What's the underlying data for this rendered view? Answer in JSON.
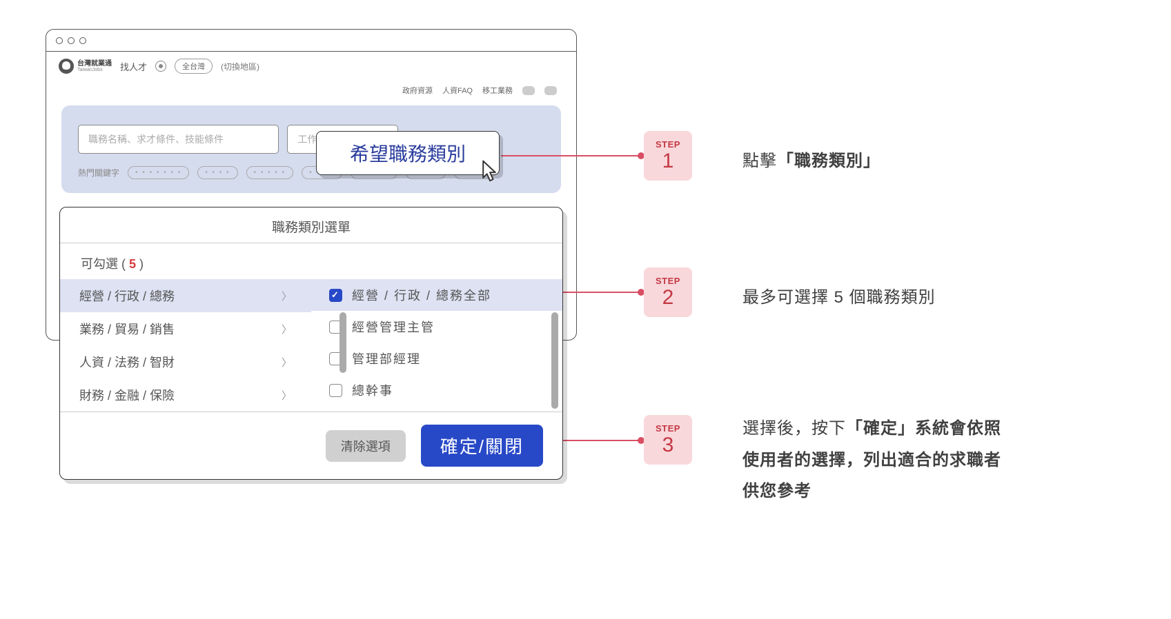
{
  "browser": {
    "logo_cn": "台灣就業通",
    "logo_en": "TaiwanJobs",
    "find_talent": "找人才",
    "location": "全台灣",
    "switch_area": "(切換地區)",
    "subnav": {
      "gov": "政府資源",
      "faq": "人資FAQ",
      "migrant": "移工業務"
    }
  },
  "search": {
    "placeholder_keyword": "職務名稱、求才條件、技能條件",
    "placeholder_location": "工作地點",
    "hot_label": "熱門關鍵字",
    "dots": "•  •  •  •  •  •  •",
    "dots_s": "•  •  •  •",
    "dots_m": "•  •  •  •  •"
  },
  "job_cat_button": "希望職務類別",
  "modal": {
    "title": "職務類別選單",
    "selectable_prefix": "可勾選 ( ",
    "selectable_count": "5",
    "selectable_suffix": " )",
    "categories": [
      {
        "label": "經營 / 行政 / 總務",
        "active": true
      },
      {
        "label": "業務 / 貿易 / 銷售",
        "active": false
      },
      {
        "label": "人資 / 法務 / 智財",
        "active": false
      },
      {
        "label": "財務 / 金融 / 保險",
        "active": false
      }
    ],
    "subcategories": [
      {
        "label": "經營 / 行政 / 總務全部",
        "checked": true
      },
      {
        "label": "經營管理主管",
        "checked": false
      },
      {
        "label": "管理部經理",
        "checked": false
      },
      {
        "label": "總幹事",
        "checked": false
      }
    ],
    "clear": "清除選項",
    "confirm": "確定/關閉"
  },
  "steps": {
    "label": "STEP",
    "s1": "1",
    "s2": "2",
    "s3": "3",
    "exp1_a": "點擊",
    "exp1_b": "「職務類別」",
    "exp2": "最多可選擇 5 個職務類別",
    "exp3_a": "選擇後，按下",
    "exp3_b": "「確定」系統會依照使用者的選擇，列出適合的求職者供您參考"
  }
}
